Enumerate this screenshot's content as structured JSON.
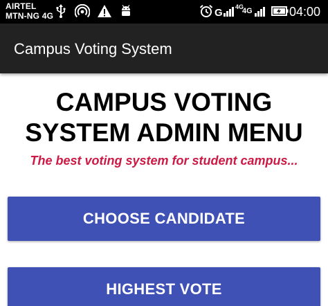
{
  "status_bar": {
    "carrier_1": "AIRTEL",
    "carrier_2": "MTN-NG 4G",
    "network_1": "4G",
    "network_2": "4G",
    "time": "04:00",
    "icons": [
      "usb-icon",
      "hotspot-icon",
      "warning-icon",
      "android-debug-icon",
      "alarm-icon",
      "signal-icon",
      "signal-icon",
      "battery-charging-icon"
    ]
  },
  "app_bar": {
    "title": "Campus Voting System"
  },
  "main": {
    "heading_line_1": "CAMPUS VOTING",
    "heading_line_2": "SYSTEM ADMIN MENU",
    "tagline": "The best voting system for student campus...",
    "buttons": [
      {
        "label": "CHOOSE CANDIDATE"
      },
      {
        "label": "HIGHEST VOTE"
      }
    ]
  },
  "colors": {
    "status_bar_bg": "#000000",
    "app_bar_bg": "#222222",
    "button_bg": "#3f51b5",
    "tagline": "#cc1a45",
    "page_bg": "#ffffff"
  }
}
